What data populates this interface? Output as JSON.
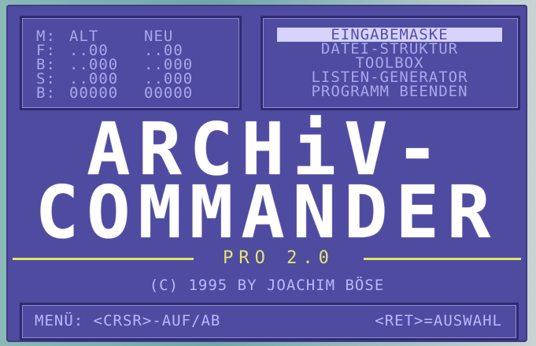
{
  "status_panel": {
    "headers": [
      "M:",
      "ALT",
      "NEU"
    ],
    "rows": [
      {
        "label": "F:",
        "alt": "..00",
        "neu": "..00"
      },
      {
        "label": "B:",
        "alt": "..000",
        "neu": "..000"
      },
      {
        "label": "S:",
        "alt": "..000",
        "neu": "..000"
      },
      {
        "label": "B:",
        "alt": "00000",
        "neu": "00000"
      }
    ]
  },
  "menu": {
    "items": [
      {
        "label": "EINGABEMASKE",
        "selected": true
      },
      {
        "label": "DATEI-STRUKTUR",
        "selected": false
      },
      {
        "label": "TOOLBOX",
        "selected": false
      },
      {
        "label": "LISTEN-GENERATOR",
        "selected": false
      },
      {
        "label": "PROGRAMM BEENDEN",
        "selected": false
      }
    ]
  },
  "title": {
    "line1": "ARCHiV-",
    "line2": "COMMANDER"
  },
  "version": "PRO 2.0",
  "copyright": "(C) 1995 BY JOACHIM BÖSE",
  "help": {
    "left": "MENÜ: <CRSR>-AUF/AB",
    "right": "<RET>=AUSWAHL"
  }
}
